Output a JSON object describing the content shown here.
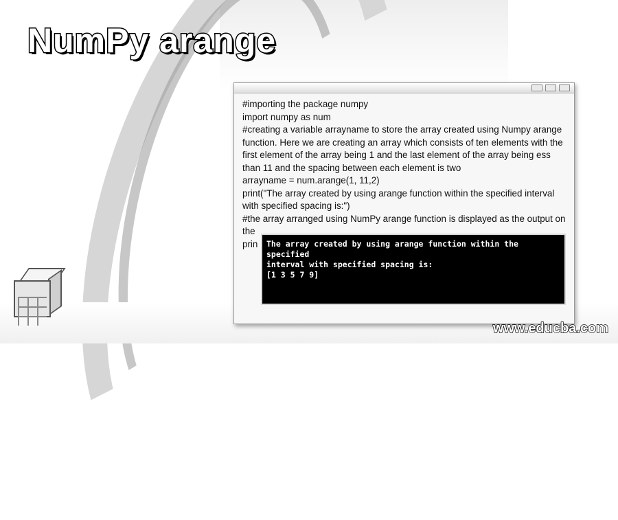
{
  "title": "NumPy arange",
  "code_lines": [
    "#importing the package numpy",
    "import numpy as num",
    "#creating a variable arrayname to store the array created using Numpy arange function. Here we are creating an array which consists of ten elements with the first element of the array being 1 and the last element of the array being ess than 11 and the spacing between each element is two",
    "arrayname = num.arange(1, 11,2)",
    "print(\"The array created by using arange function within the specified interval with specified spacing is:\")",
    "#the array arranged using NumPy arange function is displayed as the output on the",
    "prin"
  ],
  "console_output": [
    "The array created by using arange function within the specified",
    "interval with specified spacing is:",
    "[1 3 5 7 9]"
  ],
  "watermark": "www.educba.com"
}
